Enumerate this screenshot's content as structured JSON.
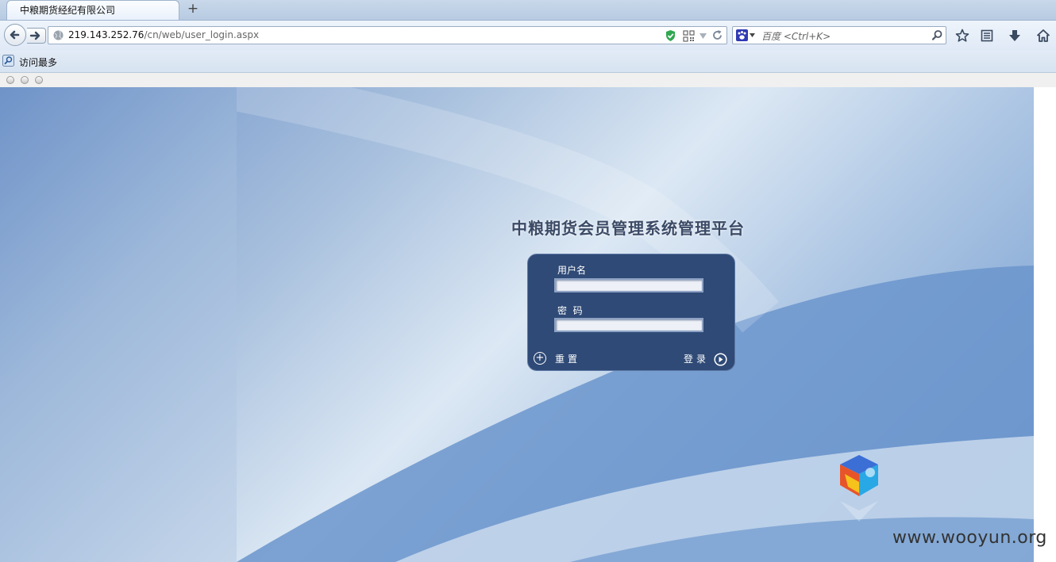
{
  "browser": {
    "tab_title": "中粮期货经纪有限公司",
    "new_tab_symbol": "+",
    "url_host": "219.143.252.76",
    "url_path": "/cn/web/user_login.aspx",
    "search_placeholder": "百度 <Ctrl+K>",
    "bookmark_label": "访问最多"
  },
  "login": {
    "title": "中粮期货会员管理系统管理平台",
    "username_label": "用户名",
    "password_label": "密  码",
    "username_value": "",
    "password_value": "",
    "reset_label": "重置",
    "submit_label": "登录"
  },
  "watermark": "www.wooyun.org",
  "colors": {
    "login_box": "#2f4a76",
    "title_text": "#3b4a66",
    "background_blue": "#6b95cc"
  }
}
